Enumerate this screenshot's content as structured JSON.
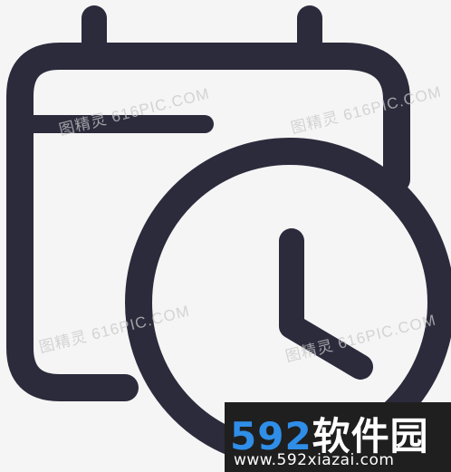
{
  "icon": {
    "name": "calendar-clock-icon",
    "stroke_color": "#2b2b3c",
    "background_color": "#f5f5f5"
  },
  "watermarks": [
    {
      "text": "图精灵 616PIC.COM"
    },
    {
      "text": "图精灵 616PIC.COM"
    },
    {
      "text": "图精灵 616PIC.COM"
    },
    {
      "text": "图精灵 616PIC.COM"
    }
  ],
  "banner": {
    "number": "592",
    "title": "软件园",
    "url": "www.592xiazai.com",
    "number_color": "#2f8ee8",
    "background_color": "#1f1f1f"
  }
}
